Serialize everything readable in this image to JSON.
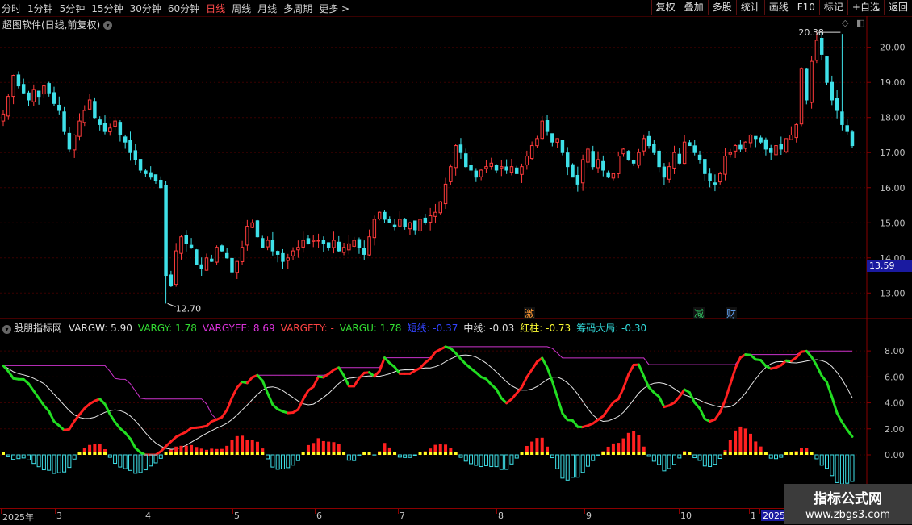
{
  "toolbar": {
    "periods": [
      "分时",
      "1分钟",
      "5分钟",
      "15分钟",
      "30分钟",
      "60分钟",
      "日线",
      "周线",
      "月线",
      "多周期",
      "更多 >"
    ],
    "active_period": "日线",
    "right_buttons": [
      "复权",
      "叠加",
      "多股",
      "统计",
      "画线",
      "F10",
      "标记",
      "+自选",
      "返回"
    ]
  },
  "chart": {
    "title": "超图软件(日线,前复权)",
    "price_axis": [
      "20.00",
      "19.00",
      "18.00",
      "17.00",
      "16.00",
      "15.00",
      "14.00",
      "13.00"
    ],
    "high_label": "20.38",
    "low_label": "12.70",
    "current_price": "13.59",
    "markers": [
      {
        "text": "激",
        "color": "#ff9933"
      },
      {
        "text": "减",
        "color": "#33cc66"
      },
      {
        "text": "财",
        "color": "#66aaff"
      }
    ]
  },
  "indicator": {
    "name": "股朋指标网",
    "values": [
      {
        "text": "VARGW: 5.90",
        "color": "#e0e0e0"
      },
      {
        "text": "VARGY: 1.78",
        "color": "#33dd33"
      },
      {
        "text": "VARGYEE: 8.69",
        "color": "#dd33dd"
      },
      {
        "text": "VARGETY: -",
        "color": "#ff4444"
      },
      {
        "text": "VARGU: 1.78",
        "color": "#33dd33"
      },
      {
        "text": "短线: -0.37",
        "color": "#3344ff"
      },
      {
        "text": "中线: -0.03",
        "color": "#e0e0e0"
      },
      {
        "text": "红柱: -0.73",
        "color": "#ffff33"
      },
      {
        "text": "筹码大局: -0.30",
        "color": "#33dddd"
      }
    ],
    "axis": [
      "8.00",
      "6.00",
      "4.00",
      "2.00",
      "0.00"
    ]
  },
  "dates": [
    "2025年",
    "3",
    "4",
    "5",
    "6",
    "7",
    "8",
    "9",
    "10",
    "1",
    "2025/"
  ],
  "watermark": {
    "line1": "指标公式网",
    "line2": "www.zbgs3.com"
  },
  "chart_data": {
    "type": "candlestick",
    "title": "超图软件(日线,前复权)",
    "yrange": [
      12.5,
      20.5
    ],
    "annotations": {
      "high": 20.38,
      "low": 12.7,
      "last": 13.59
    },
    "closes": [
      18.1,
      18.6,
      19.2,
      18.9,
      18.7,
      18.5,
      18.8,
      18.6,
      18.9,
      18.7,
      18.4,
      18.2,
      17.6,
      17.1,
      17.5,
      17.9,
      18.2,
      18.5,
      18.0,
      17.8,
      17.6,
      17.7,
      17.9,
      17.5,
      17.3,
      17.0,
      16.8,
      16.5,
      16.4,
      16.3,
      16.2,
      16.0,
      13.5,
      13.2,
      14.2,
      14.6,
      14.4,
      14.3,
      13.8,
      13.7,
      14.0,
      13.9,
      14.3,
      14.2,
      14.0,
      13.6,
      13.9,
      14.3,
      14.9,
      15.0,
      14.6,
      14.3,
      14.5,
      14.2,
      14.1,
      13.9,
      14.0,
      14.2,
      14.3,
      14.5,
      14.4,
      14.5,
      14.5,
      14.4,
      14.3,
      14.5,
      14.2,
      14.3,
      14.4,
      14.5,
      14.3,
      14.1,
      14.6,
      15.1,
      15.3,
      15.1,
      15.0,
      14.9,
      15.1,
      14.9,
      15.0,
      14.8,
      15.1,
      15.0,
      15.2,
      15.3,
      15.6,
      16.1,
      16.6,
      17.2,
      17.0,
      16.6,
      16.5,
      16.3,
      16.5,
      16.6,
      16.7,
      16.5,
      16.6,
      16.5,
      16.6,
      16.4,
      16.6,
      16.9,
      17.2,
      17.4,
      17.9,
      17.6,
      17.3,
      17.4,
      17.0,
      16.6,
      16.3,
      16.1,
      16.8,
      17.1,
      16.6,
      16.8,
      16.5,
      16.3,
      16.4,
      16.9,
      17.1,
      16.8,
      16.7,
      17.0,
      17.4,
      17.2,
      17.0,
      16.6,
      16.3,
      16.6,
      17.0,
      16.7,
      17.3,
      17.2,
      17.0,
      16.8,
      16.4,
      16.2,
      16.1,
      16.4,
      16.9,
      17.0,
      17.2,
      17.1,
      17.3,
      17.5,
      17.4,
      17.3,
      17.1,
      17.0,
      17.2,
      17.1,
      17.4,
      17.5,
      17.8,
      19.4,
      18.5,
      19.6,
      20.2,
      19.8,
      19.0,
      18.5,
      18.2,
      17.8,
      17.6,
      17.2
    ]
  }
}
